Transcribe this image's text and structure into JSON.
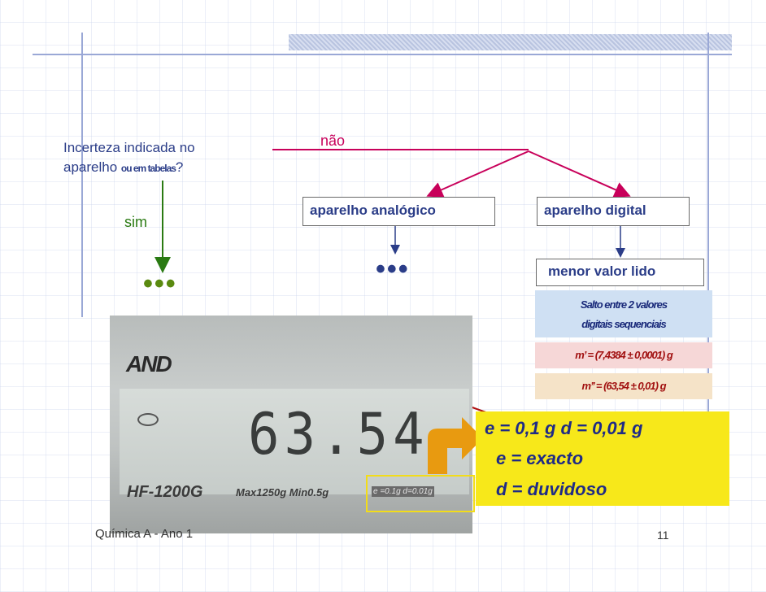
{
  "question": {
    "line1": "Incerteza indicada no",
    "line2_main": "aparelho ",
    "line2_small": "ou em tabelas",
    "line2_end": "?"
  },
  "branch_no": "não",
  "branch_yes": "sim",
  "analog_box": "aparelho analógico",
  "digital_box": "aparelho digital",
  "dots_sim": "•••",
  "dots_analog": "•••",
  "menor_box": "menor valor lido",
  "salto": {
    "line1": "Salto entre 2 valores",
    "line2": "digitais sequenciais"
  },
  "mass1": "m’ = (7,4384 ± 0,0001) g",
  "mass2": "m’’ = (63,54 ± 0,01) g",
  "photo": {
    "brand": "AND",
    "reading": "63.54",
    "model": "HF-1200G",
    "specs": "Max1250g  Min0.5g",
    "ed_label": "e =0.1g  d=0.01g"
  },
  "callout": {
    "line1": "e = 0,1 g    d = 0,01 g",
    "line2": "e = exacto",
    "line3": "d = duvidoso"
  },
  "footer": {
    "course": "Química A -  Ano 1",
    "page": "11"
  },
  "colors": {
    "text_blue": "#2b3d88",
    "no_branch": "#c8005a",
    "yes_branch": "#2a7a12",
    "callout_bg": "#f7e81a",
    "arrow_orange": "#e89a10"
  }
}
